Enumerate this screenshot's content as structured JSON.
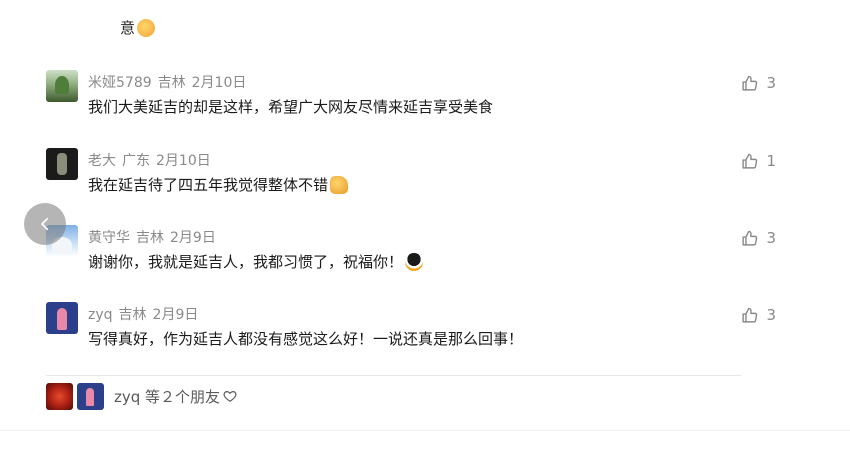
{
  "top_fragment": {
    "text": "意",
    "emoji": "handshake-emoji"
  },
  "comments": [
    {
      "user": "米娅5789",
      "location": "吉林",
      "date": "2月10日",
      "text": "我们大美延吉的却是这样，希望广大网友尽情来延吉享受美食",
      "likes": "3",
      "avatar": "tree-avatar"
    },
    {
      "user": "老大",
      "location": "广东",
      "date": "2月10日",
      "text": "我在延吉待了四五年我觉得整体不错",
      "emoji": "thumbs-up-emoji",
      "likes": "1",
      "avatar": "dark-figure-avatar"
    },
    {
      "user": "黄守华",
      "location": "吉林",
      "date": "2月9日",
      "text": "谢谢你，我就是延吉人，我都习惯了，祝福你！",
      "emoji": "penguin-emoji",
      "likes": "3",
      "avatar": "snow-tree-avatar"
    },
    {
      "user": "zyq",
      "location": "吉林",
      "date": "2月9日",
      "text": "写得真好，作为延吉人都没有感觉这么好！一说还真是那么回事！",
      "likes": "3",
      "avatar": "girl-avatar"
    }
  ],
  "friends_summary": {
    "text": "zyq 等２个朋友",
    "icon": "heart-outline-icon"
  },
  "icons": {
    "like": "thumbs-up-outline-icon",
    "back": "chevron-left-icon"
  },
  "colors": {
    "meta": "#8a8a8a",
    "text": "#1a1a1a",
    "back_button": "#787878"
  }
}
